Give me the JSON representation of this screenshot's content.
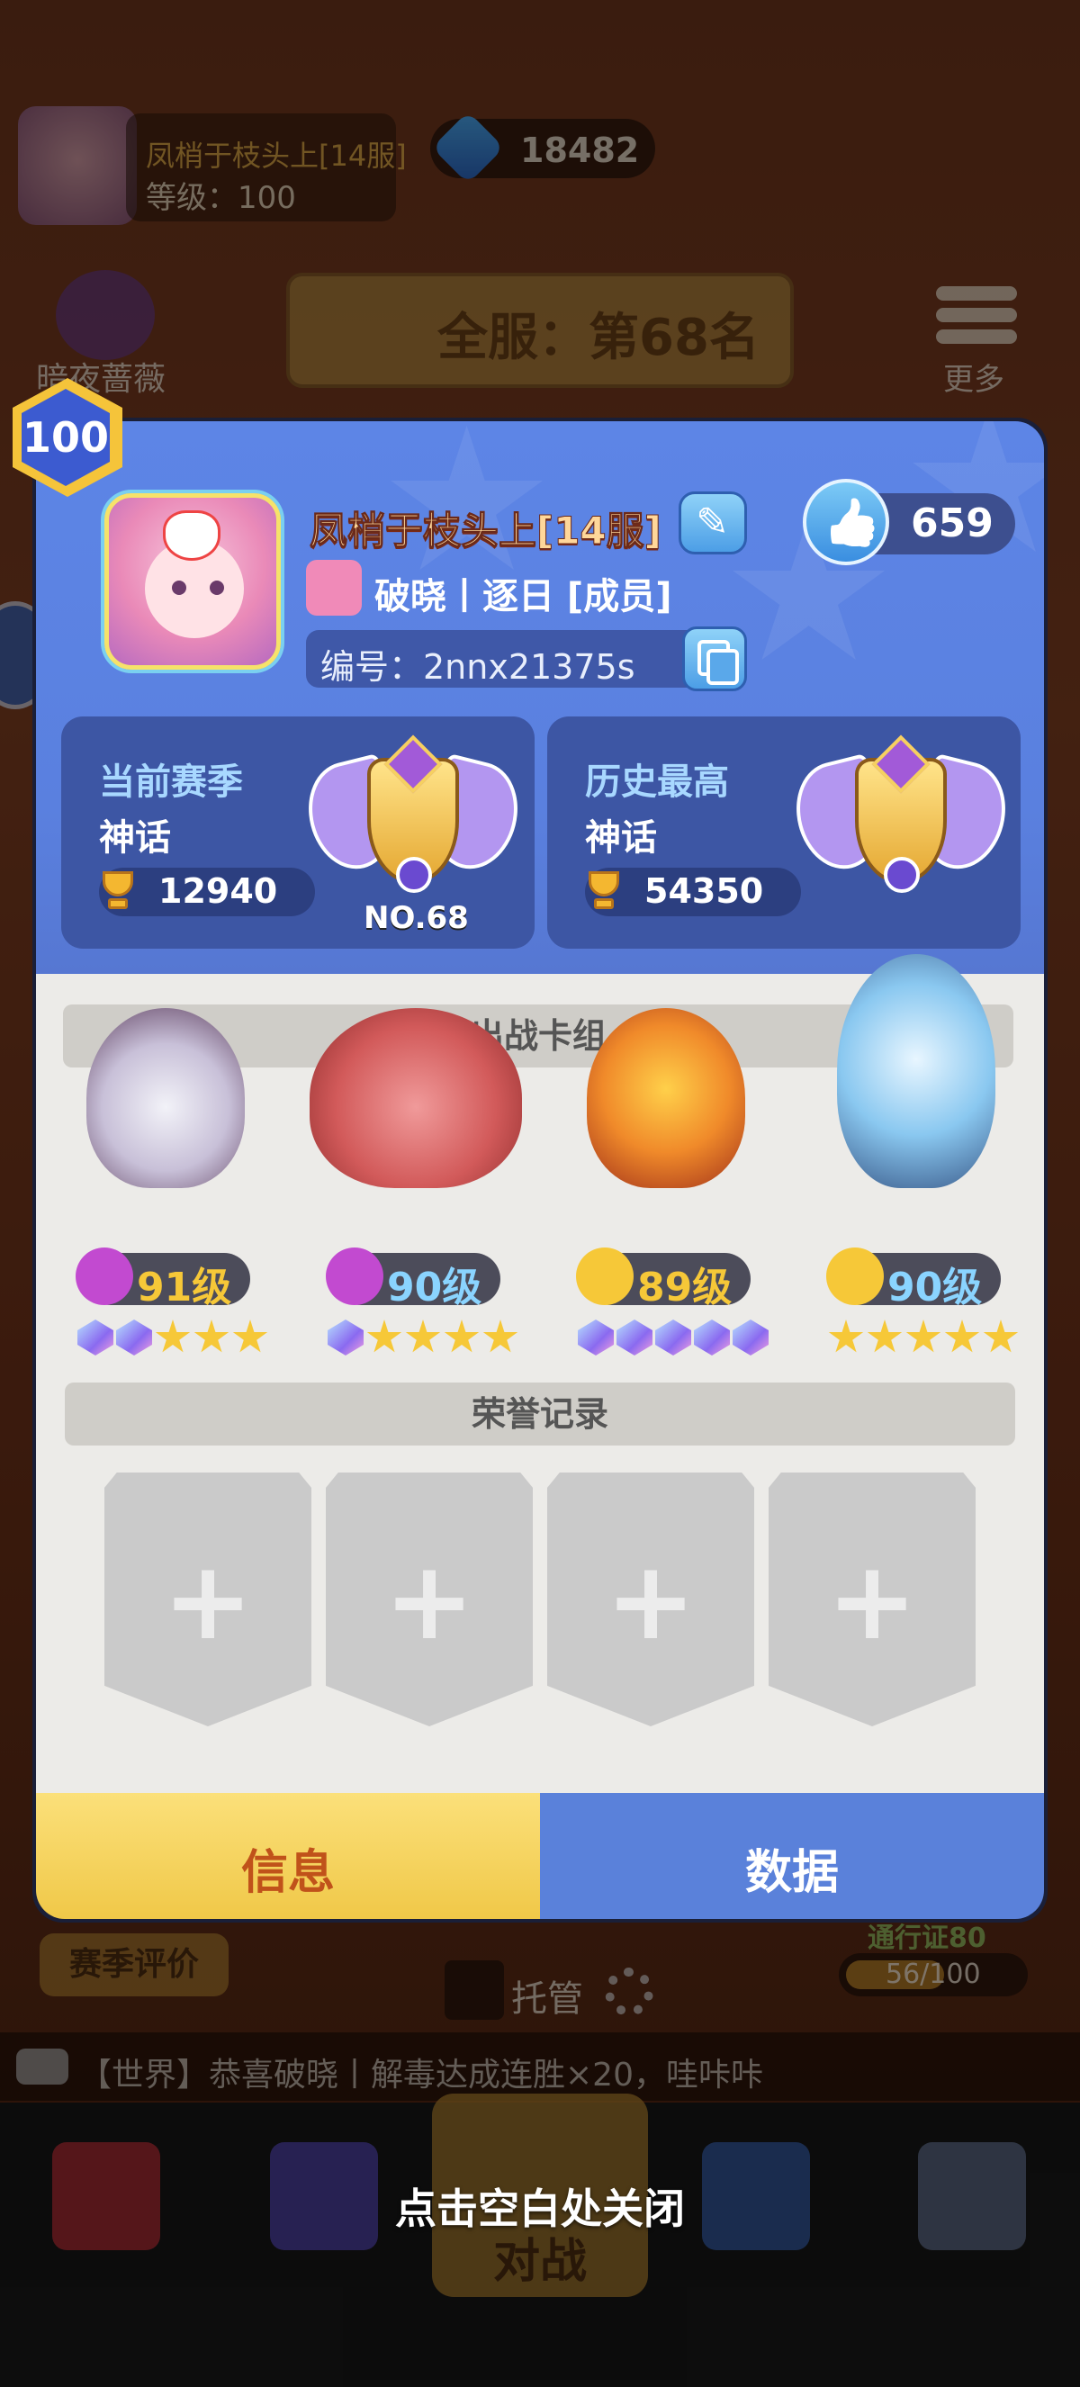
{
  "background": {
    "player_name": "凤梢于枝头上[14服]",
    "level_text": "等级：100",
    "gems": "18482",
    "rank_banner": "全服：第68名",
    "rose_label": "暗夜蔷薇",
    "more_label": "更多",
    "season_review": "赛季评价",
    "auto_label": "托管",
    "pass_title": "通行证80",
    "pass_progress": "56/100",
    "pass_fraction": 0.56,
    "ticker": "【世界】恭喜破晓丨解毒达成连胜×20，哇咔咔",
    "battle_label": "对战"
  },
  "close_hint": "点击空白处关闭",
  "profile": {
    "level": "100",
    "name": "凤梢于枝头上[14服]",
    "likes": "659",
    "guild": "破晓丨逐日 [成员]",
    "id_text": "编号：2nnx21375s"
  },
  "season": {
    "current": {
      "title": "当前赛季",
      "tier": "神话",
      "trophies": "12940",
      "rank": "NO.68"
    },
    "best": {
      "title": "历史最高",
      "tier": "神话",
      "trophies": "54350"
    }
  },
  "deck": {
    "title": "出战卡组",
    "heroes": [
      {
        "level": "91级",
        "stars": [
          "gem",
          "gem",
          "star",
          "star",
          "star"
        ]
      },
      {
        "level": "90级",
        "stars": [
          "gem",
          "star",
          "star",
          "star",
          "star"
        ]
      },
      {
        "level": "89级",
        "stars": [
          "gem",
          "gem",
          "gem",
          "gem",
          "gem"
        ]
      },
      {
        "level": "90级",
        "stars": [
          "star",
          "star",
          "star",
          "star",
          "star"
        ]
      }
    ]
  },
  "honor": {
    "title": "荣誉记录",
    "slot_symbol": "+"
  },
  "tabs": {
    "info": "信息",
    "data": "数据"
  },
  "colors": {
    "panel_blue": "#5d85e6",
    "tab_active": "#f0c848",
    "tab_inactive": "#5a81da"
  }
}
